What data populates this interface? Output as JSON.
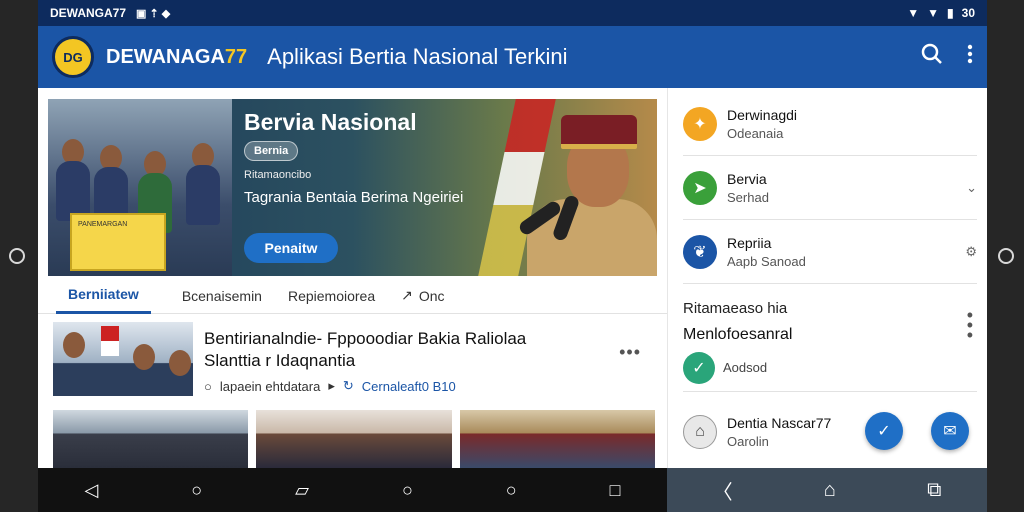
{
  "status_bar": {
    "carrier": "DEWANGA77",
    "time": "30"
  },
  "app_bar": {
    "logo_text": "DG",
    "brand_name": "DEWANAGA",
    "brand_number": "77",
    "title": "Aplikasi Bertia Nasional Terkini",
    "search_icon": "search-icon",
    "menu_icon": "more-vert-icon"
  },
  "hero": {
    "title": "Bervia Nasional",
    "badge": "Bernia",
    "subtitle": "Ritamaoncibo",
    "headline": "Tagrania Bentaia Berima Ngeiriei",
    "button": "Penaitw",
    "sign_text": "PANEMARGAN"
  },
  "tabs": [
    {
      "label": "Berniiatew"
    },
    {
      "label": "Bcenaisemin"
    },
    {
      "label": "Repiemoiorea"
    },
    {
      "label": "Onc"
    }
  ],
  "article": {
    "title_line1": "Bentirianalndie- Fppooodiar Bakia Raliolaa",
    "title_line2": "Slanttia r Idaqnantia",
    "meta_left": "lapaein ehtdatara",
    "meta_link": "Cernaleaft0 B10"
  },
  "sidebar": {
    "items": [
      {
        "title": "Derwinagdi",
        "subtitle": "Odeanaia",
        "icon": "emblem-icon",
        "color": "#f3a623"
      },
      {
        "title": "Bervia",
        "subtitle": "Serhad",
        "icon": "megaphone-icon",
        "color": "#3aa03a"
      },
      {
        "title": "Repriia",
        "subtitle": "Aapb Sanoad",
        "icon": "wheat-icon",
        "color": "#1b55a6"
      }
    ],
    "block_line1": "Ritamaeaso hia",
    "block_line2": "Menlofoesanral",
    "block_sub": "Aodsod",
    "bottom_item": {
      "title": "Dentia Nascar77",
      "subtitle": "Oarolin"
    }
  },
  "nav": {
    "left": [
      "back-icon",
      "home-icon",
      "recents-icon",
      "home-icon",
      "home-icon",
      "recents-icon"
    ],
    "right": [
      "back-icon",
      "home-icon",
      "recents-icon"
    ]
  }
}
